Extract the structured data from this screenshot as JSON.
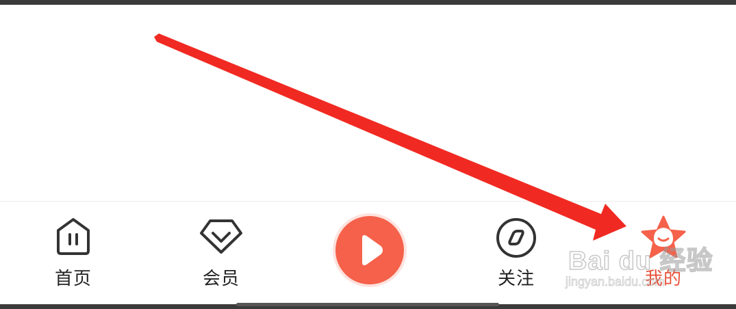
{
  "tabs": [
    {
      "id": "home",
      "label": "首页",
      "icon": "home-icon"
    },
    {
      "id": "vip",
      "label": "会员",
      "icon": "diamond-icon"
    },
    {
      "id": "play",
      "label": "",
      "icon": "play-icon"
    },
    {
      "id": "follow",
      "label": "关注",
      "icon": "compass-icon"
    },
    {
      "id": "mine",
      "label": "我的",
      "icon": "star-mascot-icon",
      "selected": true
    }
  ],
  "colors": {
    "accent": "#f5614a",
    "annotation_arrow": "#f02a22",
    "text": "#222222"
  },
  "watermark": {
    "brand": "Bai du 经验",
    "sub": "jingyan.baidu.com"
  }
}
